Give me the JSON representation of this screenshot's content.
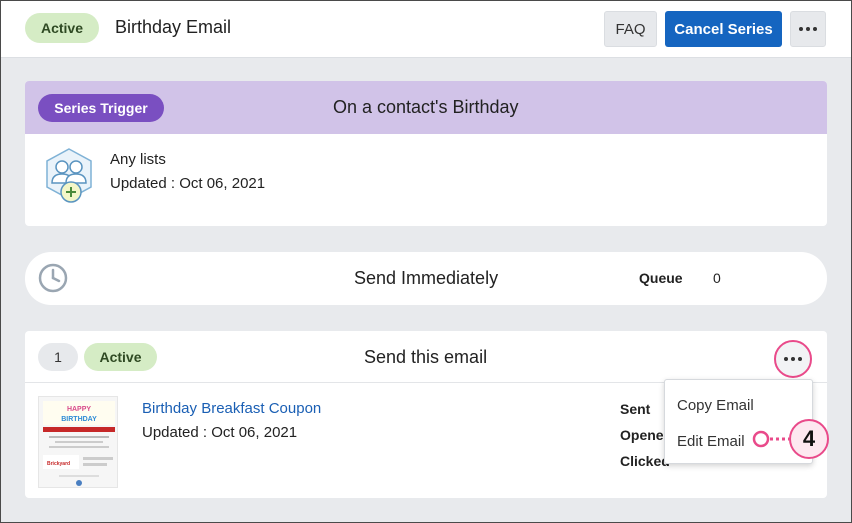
{
  "header": {
    "status_badge": "Active",
    "title": "Birthday Email",
    "faq_label": "FAQ",
    "cancel_label": "Cancel Series",
    "more_icon": "more-horizontal-icon"
  },
  "trigger": {
    "badge": "Series Trigger",
    "heading": "On a contact's Birthday",
    "icon": "contacts-add-icon",
    "lists_text": "Any lists",
    "updated_text": "Updated : Oct 06, 2021"
  },
  "send_timing": {
    "icon": "clock-icon",
    "heading": "Send Immediately",
    "queue_label": "Queue",
    "queue_value": "0"
  },
  "email_step": {
    "step_number": "1",
    "status_badge": "Active",
    "heading": "Send this email",
    "email_name": "Birthday Breakfast Coupon",
    "updated_text": "Updated : Oct 06, 2021",
    "thumbnail_text": "HAPPY BIRTHDAY",
    "stats": {
      "sent_label": "Sent",
      "opened_label": "Opened",
      "clicked_label": "Clicked"
    }
  },
  "dropdown": {
    "items": [
      "Copy Email",
      "Edit Email"
    ]
  },
  "callout": {
    "number": "4",
    "color": "#e94a8a"
  },
  "colors": {
    "accent_blue": "#1565c0",
    "purple_badge": "#7a4fc1",
    "trigger_band": "#d1c3e8",
    "active_green": "#d5ecc5"
  }
}
